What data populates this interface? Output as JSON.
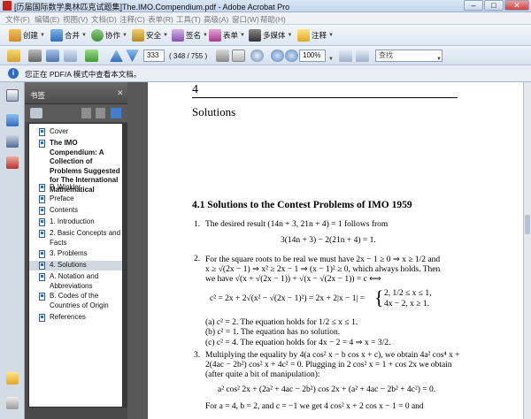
{
  "window": {
    "title": "[历届国际数学奥林匹克试题集]The.IMO.Compendium.pdf - Adobe Acrobat Pro",
    "min": "–",
    "max": "□",
    "close": "✕"
  },
  "menu": [
    "文件(F)",
    "编辑(E)",
    "视图(V)",
    "文档(D)",
    "注释(C)",
    "表单(R)",
    "工具(T)",
    "高级(A)",
    "窗口(W)",
    "帮助(H)"
  ],
  "toolbar": {
    "create": "创建",
    "combine": "合并",
    "collaborate": "协作",
    "security": "安全",
    "sign": "签名",
    "forms": "表单",
    "multimedia": "多媒体",
    "comment": "注释"
  },
  "nav": {
    "page_value": "333",
    "page_count": "( 348 / 755 )",
    "zoom": "100%",
    "search_placeholder": "查找"
  },
  "infobar": {
    "text": "您正在 PDF/A 模式中查看本文档。"
  },
  "bookmarks": {
    "title": "书签",
    "items": [
      {
        "label": "Cover",
        "bold": false,
        "selected": false
      },
      {
        "label": "The IMO Compendium: A Collection of Problems Suggested for The International Mathematical",
        "bold": true,
        "selected": false
      },
      {
        "label": "P. Winkler",
        "bold": false,
        "selected": false
      },
      {
        "label": "Preface",
        "bold": false,
        "selected": false
      },
      {
        "label": "Contents",
        "bold": false,
        "selected": false
      },
      {
        "label": "1. Introduction",
        "bold": false,
        "selected": false
      },
      {
        "label": "2. Basic Concepts and Facts",
        "bold": false,
        "selected": false
      },
      {
        "label": "3. Problems",
        "bold": false,
        "selected": false
      },
      {
        "label": "4. Solutions",
        "bold": false,
        "selected": true
      },
      {
        "label": "A. Notation and Abbreviations",
        "bold": false,
        "selected": false
      },
      {
        "label": "B. Codes of the Countries of Origin",
        "bold": false,
        "selected": false
      },
      {
        "label": "References",
        "bold": false,
        "selected": false
      }
    ]
  },
  "document": {
    "chapter_num": "4",
    "chapter_title": "Solutions",
    "section": "4.1 Solutions to the Contest Problems of IMO 1959",
    "p1_num": "1.",
    "p1_text": "The desired result (14n + 3, 21n + 4) = 1 follows from",
    "p1_eq": "3(14n + 3) − 2(21n + 4) = 1.",
    "p2_num": "2.",
    "p2_l1": "For the square roots to be real we must have 2x − 1 ≥ 0 ⇒ x ≥ 1/2 and",
    "p2_l2": "x ≥ √(2x − 1) ⇒ x² ≥ 2x − 1 ⇒ (x − 1)² ≥ 0, which always holds. Then",
    "p2_l3": "we have √(x + √(2x − 1)) + √(x − √(2x − 1)) = c ⟺",
    "p2_eq_left": "c² = 2x + 2√(x² − √(2x − 1)²) = 2x + 2|x − 1| =",
    "p2_case1": "2,        1/2 ≤ x ≤ 1,",
    "p2_case2": "4x − 2, x ≥ 1.",
    "p2_a": "(a)  c² = 2. The equation holds for 1/2 ≤ x ≤ 1.",
    "p2_b": "(b)  c² = 1. The equation has no solution.",
    "p2_c": "(c)  c² = 4. The equation holds for 4x − 2 = 4 ⇒ x = 3/2.",
    "p3_num": "3.",
    "p3_l1": "Multiplying the equality by 4(a cos² x − b cos x + c), we obtain 4a² cos⁴ x +",
    "p3_l2": "2(4ac − 2b²) cos² x + 4c² = 0. Plugging in 2 cos² x = 1 + cos 2x we obtain",
    "p3_l3": "(after quite a bit of manipulation):",
    "p3_eq": "a² cos² 2x + (2a² + 4ac − 2b²) cos 2x + (a² + 4ac − 2b² + 4c²) = 0.",
    "p3_l4": "For  a = 4,  b = 2,  and  c = −1  we get 4 cos² x + 2 cos x − 1 = 0  and"
  },
  "colors": {
    "accent": "#2f6cc0",
    "panel": "#4a4a4a",
    "acrobat_red": "#c8211b"
  }
}
